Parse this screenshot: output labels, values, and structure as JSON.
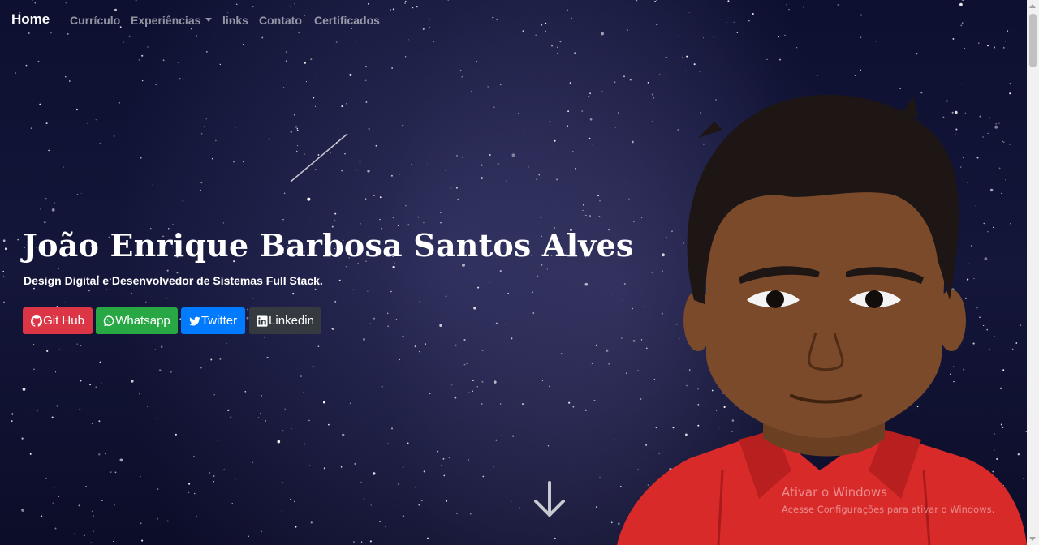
{
  "navbar": {
    "brand": "Home",
    "items": [
      {
        "label": "Currículo"
      },
      {
        "label": "Experiências",
        "dropdown": true
      },
      {
        "label": "links"
      },
      {
        "label": "Contato"
      },
      {
        "label": "Certificados"
      }
    ]
  },
  "hero": {
    "title": "João Enrique Barbosa Santos Alves",
    "subtitle": "Design Digital e Desenvolvedor de Sistemas Full Stack."
  },
  "buttons": {
    "github": {
      "label": "Git Hub",
      "icon": "github-icon",
      "color": "#dc3545"
    },
    "whatsapp": {
      "label": "Whatsapp",
      "icon": "whatsapp-icon",
      "color": "#28a745"
    },
    "twitter": {
      "label": "Twitter",
      "icon": "twitter-icon",
      "color": "#007bff"
    },
    "linkedin": {
      "label": "Linkedin",
      "icon": "linkedin-icon",
      "color": "#343a40"
    }
  },
  "scroll_hint": {
    "icon": "arrow-down-icon"
  },
  "watermark": {
    "title": "Ativar o Windows",
    "subtitle": "Acesse Configurações para ativar o Windows."
  },
  "colors": {
    "background": "#0d1030",
    "nav_text": "#a7a7b4",
    "shirt": "#d92a2a",
    "skin": "#7a4a2a",
    "hair": "#1d1614"
  }
}
